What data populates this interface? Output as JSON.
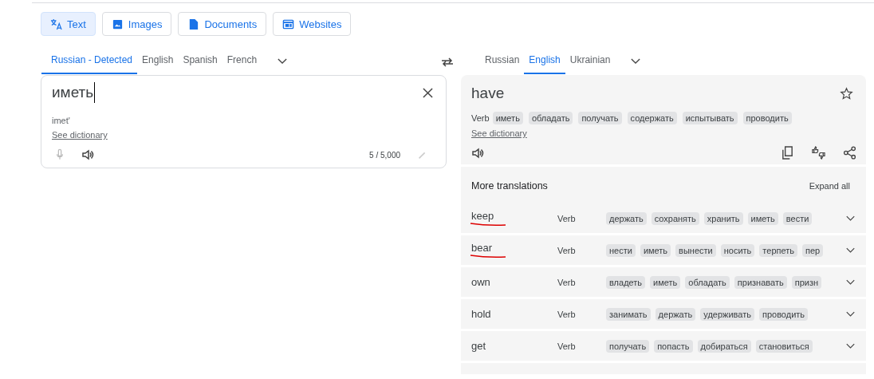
{
  "modes": [
    {
      "kind": "text",
      "label": "Text",
      "selected": true
    },
    {
      "kind": "images",
      "label": "Images",
      "selected": false
    },
    {
      "kind": "documents",
      "label": "Documents",
      "selected": false
    },
    {
      "kind": "websites",
      "label": "Websites",
      "selected": false
    }
  ],
  "source_languages": [
    {
      "label": "Russian - Detected",
      "selected": true
    },
    {
      "label": "English",
      "selected": false
    },
    {
      "label": "Spanish",
      "selected": false
    },
    {
      "label": "French",
      "selected": false
    }
  ],
  "target_languages": [
    {
      "label": "Russian",
      "selected": false
    },
    {
      "label": "English",
      "selected": true
    },
    {
      "label": "Ukrainian",
      "selected": false
    }
  ],
  "source": {
    "value": "иметь",
    "transliteration": "imet'",
    "dictionary_link": "See dictionary",
    "char_count": "5 / 5,000"
  },
  "result": {
    "text": "have",
    "part_of_speech": "Verb",
    "chips": [
      "иметь",
      "обладать",
      "получать",
      "содержать",
      "испытывать",
      "проводить"
    ],
    "dictionary_link": "See dictionary"
  },
  "more_translations": {
    "title": "More translations",
    "expand_label": "Expand all",
    "rows": [
      {
        "word": "keep",
        "underlined": true,
        "part_of_speech": "Verb",
        "chips": [
          "держать",
          "сохранять",
          "хранить",
          "иметь",
          "вести"
        ]
      },
      {
        "word": "bear",
        "underlined": true,
        "part_of_speech": "Verb",
        "chips": [
          "нести",
          "иметь",
          "вынести",
          "носить",
          "терпеть",
          "пер"
        ]
      },
      {
        "word": "own",
        "underlined": false,
        "part_of_speech": "Verb",
        "chips": [
          "владеть",
          "иметь",
          "обладать",
          "признавать",
          "призн"
        ]
      },
      {
        "word": "hold",
        "underlined": false,
        "part_of_speech": "Verb",
        "chips": [
          "занимать",
          "держать",
          "удерживать",
          "проводить"
        ]
      },
      {
        "word": "get",
        "underlined": false,
        "part_of_speech": "Verb",
        "chips": [
          "получать",
          "попасть",
          "добираться",
          "становиться"
        ]
      }
    ]
  }
}
